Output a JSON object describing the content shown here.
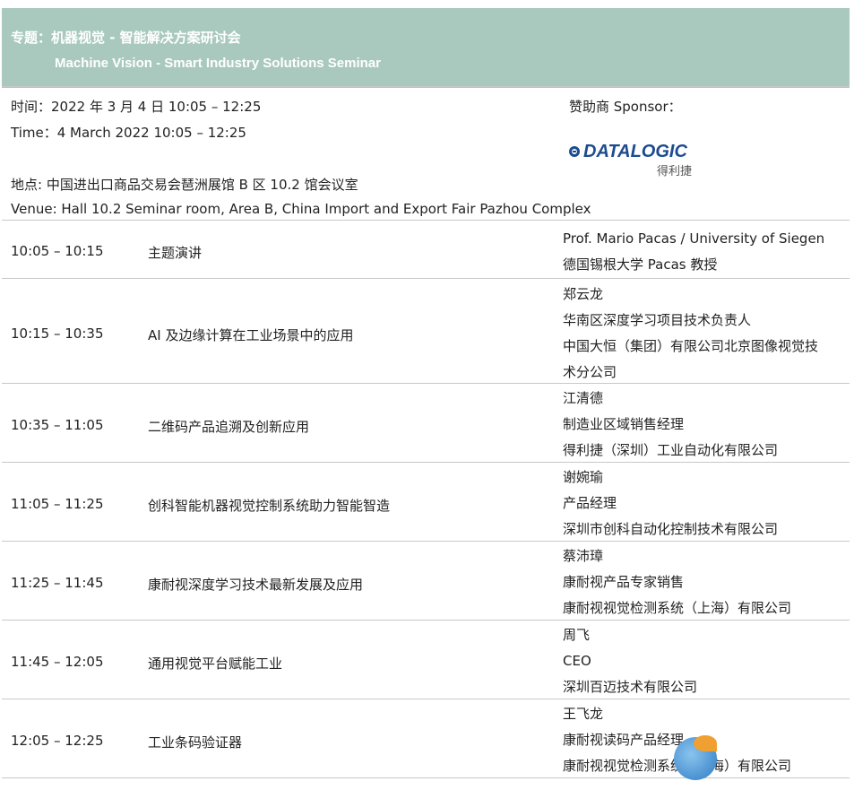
{
  "header": {
    "zh_prefix": "专题：",
    "zh_title": "机器视觉 - 智能解决方案研讨会",
    "en_title": "Machine Vision - Smart Industry Solutions Seminar"
  },
  "info": {
    "time_zh": "时间：2022 年 3 月 4 日  10:05 – 12:25",
    "time_en": "Time：4 March 2022 10:05 – 12:25",
    "venue_zh": "地点: 中国进出口商品交易会琶洲展馆  B 区 10.2 馆会议室",
    "venue_en": "Venue: Hall 10.2 Seminar room, Area B, China Import and Export Fair Pazhou Complex",
    "sponsor_label": "赞助商 Sponsor：",
    "logo_text": "DATALOGIC",
    "logo_zh": "得利捷"
  },
  "sessions": [
    {
      "time": "10:05 – 10:15",
      "topic": "主题演讲",
      "speaker": [
        "Prof. Mario Pacas / University of Siegen",
        "德国锡根大学 Pacas 教授"
      ]
    },
    {
      "time": "10:15 – 10:35",
      "topic": "AI 及边缘计算在工业场景中的应用",
      "speaker": [
        "郑云龙",
        "华南区深度学习项目技术负责人",
        "中国大恒（集团）有限公司北京图像视觉技",
        "术分公司"
      ]
    },
    {
      "time": "10:35 – 11:05",
      "topic": "二维码产品追溯及创新应用",
      "speaker": [
        "江清德",
        "制造业区域销售经理",
        "得利捷（深圳）工业自动化有限公司"
      ]
    },
    {
      "time": "11:05 – 11:25",
      "topic": "创科智能机器视觉控制系统助力智能智造",
      "speaker": [
        "谢婉瑜",
        "产品经理",
        "深圳市创科自动化控制技术有限公司"
      ]
    },
    {
      "time": "11:25 – 11:45",
      "topic": "康耐视深度学习技术最新发展及应用",
      "speaker": [
        "蔡沛璋",
        "康耐视产品专家销售",
        "康耐视视觉检测系统（上海）有限公司"
      ]
    },
    {
      "time": "11:45 – 12:05",
      "topic": "通用视觉平台赋能工业",
      "speaker": [
        "周飞",
        "CEO",
        "深圳百迈技术有限公司"
      ]
    },
    {
      "time": "12:05 – 12:25",
      "topic": "工业条码验证器",
      "speaker": [
        "王飞龙",
        "康耐视读码产品经理",
        "康耐视视觉检测系统（上海）有限公司"
      ]
    }
  ]
}
